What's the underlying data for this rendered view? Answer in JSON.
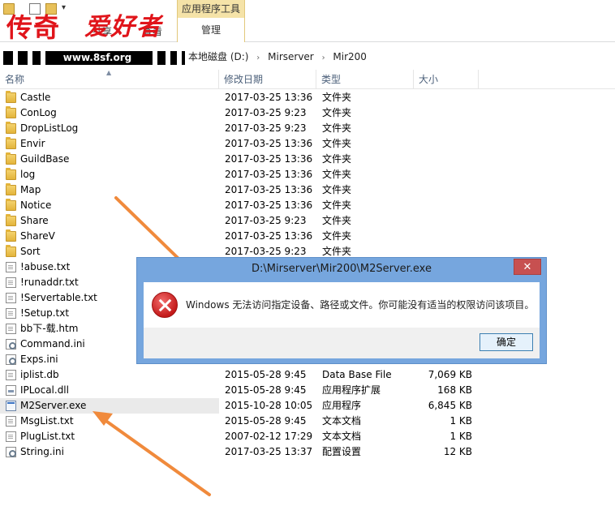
{
  "watermark": {
    "title": "传奇",
    "subtitle": "爱好者",
    "url": "www.8sf.org"
  },
  "ribbon": {
    "qat_dropdown": "▾",
    "tab_share": "共享",
    "tab_view": "查看",
    "context_tab_group": "应用程序工具",
    "context_tab": "管理"
  },
  "address": {
    "drive": "本地磁盘 (D:)",
    "crumb1": "Mirserver",
    "crumb2": "Mir200",
    "separator": "›"
  },
  "columns": {
    "name": "名称",
    "date": "修改日期",
    "type": "类型",
    "size": "大小"
  },
  "files": [
    {
      "name": "Castle",
      "date": "2017-03-25 13:36",
      "type": "文件夹",
      "size": "",
      "icon": "folder"
    },
    {
      "name": "ConLog",
      "date": "2017-03-25 9:23",
      "type": "文件夹",
      "size": "",
      "icon": "folder"
    },
    {
      "name": "DropListLog",
      "date": "2017-03-25 9:23",
      "type": "文件夹",
      "size": "",
      "icon": "folder"
    },
    {
      "name": "Envir",
      "date": "2017-03-25 13:36",
      "type": "文件夹",
      "size": "",
      "icon": "folder"
    },
    {
      "name": "GuildBase",
      "date": "2017-03-25 13:36",
      "type": "文件夹",
      "size": "",
      "icon": "folder"
    },
    {
      "name": "log",
      "date": "2017-03-25 13:36",
      "type": "文件夹",
      "size": "",
      "icon": "folder"
    },
    {
      "name": "Map",
      "date": "2017-03-25 13:36",
      "type": "文件夹",
      "size": "",
      "icon": "folder"
    },
    {
      "name": "Notice",
      "date": "2017-03-25 13:36",
      "type": "文件夹",
      "size": "",
      "icon": "folder"
    },
    {
      "name": "Share",
      "date": "2017-03-25 9:23",
      "type": "文件夹",
      "size": "",
      "icon": "folder"
    },
    {
      "name": "ShareV",
      "date": "2017-03-25 13:36",
      "type": "文件夹",
      "size": "",
      "icon": "folder"
    },
    {
      "name": "Sort",
      "date": "2017-03-25 9:23",
      "type": "文件夹",
      "size": "",
      "icon": "folder"
    },
    {
      "name": "!abuse.txt",
      "date": "",
      "type": "",
      "size": "",
      "icon": "txt"
    },
    {
      "name": "!runaddr.txt",
      "date": "",
      "type": "",
      "size": "",
      "icon": "txt"
    },
    {
      "name": "!Servertable.txt",
      "date": "",
      "type": "",
      "size": "",
      "icon": "txt"
    },
    {
      "name": "!Setup.txt",
      "date": "",
      "type": "",
      "size": "",
      "icon": "txt"
    },
    {
      "name": "bb下-载.htm",
      "date": "",
      "type": "",
      "size": "",
      "icon": "txt"
    },
    {
      "name": "Command.ini",
      "date": "",
      "type": "",
      "size": "",
      "icon": "ini"
    },
    {
      "name": "Exps.ini",
      "date": "",
      "type": "",
      "size": "",
      "icon": "ini"
    },
    {
      "name": "iplist.db",
      "date": "2015-05-28 9:45",
      "type": "Data Base File",
      "size": "7,069 KB",
      "icon": "txt"
    },
    {
      "name": "IPLocal.dll",
      "date": "2015-05-28 9:45",
      "type": "应用程序扩展",
      "size": "168 KB",
      "icon": "dll"
    },
    {
      "name": "M2Server.exe",
      "date": "2015-10-28 10:05",
      "type": "应用程序",
      "size": "6,845 KB",
      "icon": "exe",
      "selected": true
    },
    {
      "name": "MsgList.txt",
      "date": "2015-05-28 9:45",
      "type": "文本文档",
      "size": "1 KB",
      "icon": "txt"
    },
    {
      "name": "PlugList.txt",
      "date": "2007-02-12 17:29",
      "type": "文本文档",
      "size": "1 KB",
      "icon": "txt"
    },
    {
      "name": "String.ini",
      "date": "2017-03-25 13:37",
      "type": "配置设置",
      "size": "12 KB",
      "icon": "ini"
    }
  ],
  "dialog": {
    "title": "D:\\Mirserver\\Mir200\\M2Server.exe",
    "close_label": "✕",
    "message": "Windows 无法访问指定设备、路径或文件。你可能没有适当的权限访问该项目。",
    "ok_label": "确定",
    "icon": "error-icon"
  },
  "colors": {
    "arrow": "#f08a3c",
    "watermark": "#e0141a",
    "dialog_frame": "#76a6de"
  }
}
